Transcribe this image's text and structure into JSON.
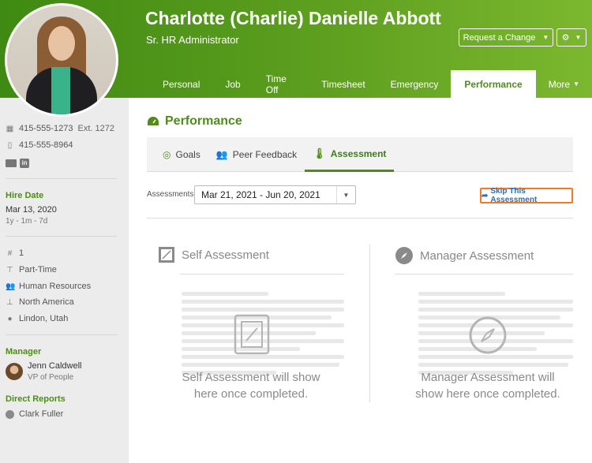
{
  "profile": {
    "name": "Charlotte (Charlie) Danielle Abbott",
    "job_title": "Sr. HR Administrator"
  },
  "header": {
    "request_change": "Request a Change",
    "tabs": [
      {
        "label": "Personal"
      },
      {
        "label": "Job"
      },
      {
        "label": "Time Off"
      },
      {
        "label": "Timesheet"
      },
      {
        "label": "Emergency"
      },
      {
        "label": "Performance",
        "active": true
      },
      {
        "label": "More"
      }
    ]
  },
  "sidebar": {
    "work_phone": "415-555-1273",
    "ext": "Ext. 1272",
    "mobile_phone": "415-555-8964",
    "hire_date_label": "Hire Date",
    "hire_date": "Mar 13, 2020",
    "tenure": "1y - 1m - 7d",
    "employee_number": "1",
    "employment_type": "Part-Time",
    "department": "Human Resources",
    "division": "North America",
    "location": "Lindon, Utah",
    "manager_label": "Manager",
    "manager_name": "Jenn Caldwell",
    "manager_title": "VP of People",
    "direct_reports_label": "Direct Reports",
    "direct_report": "Clark Fuller"
  },
  "main": {
    "title": "Performance",
    "subtabs": [
      {
        "label": "Goals"
      },
      {
        "label": "Peer Feedback"
      },
      {
        "label": "Assessment",
        "active": true
      }
    ],
    "assessments_label": "Assessments",
    "selected_period": "Mar 21, 2021 - Jun 20, 2021",
    "skip_label": "Skip This Assessment",
    "self": {
      "title": "Self Assessment",
      "message_line1": "Self Assessment will show",
      "message_line2": "here once completed."
    },
    "manager": {
      "title": "Manager Assessment",
      "message_line1": "Manager Assessment will",
      "message_line2": "show here once completed."
    }
  },
  "colors": {
    "brand_green": "#4f8c19",
    "skip_border": "#ee7a2a",
    "link_blue": "#2f6fb4"
  }
}
